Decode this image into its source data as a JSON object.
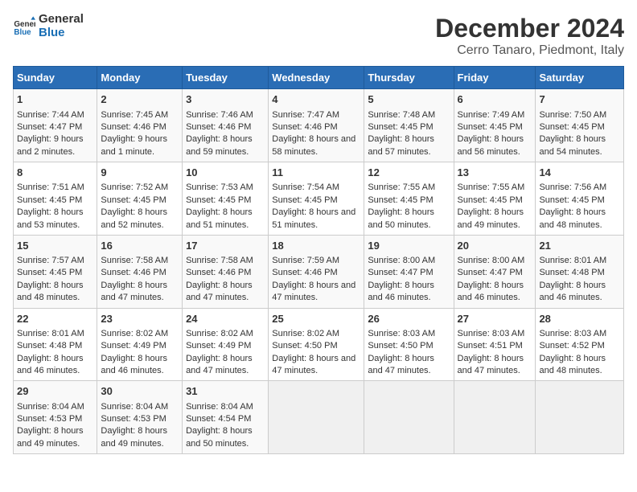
{
  "header": {
    "logo_general": "General",
    "logo_blue": "Blue",
    "title": "December 2024",
    "subtitle": "Cerro Tanaro, Piedmont, Italy"
  },
  "days_of_week": [
    "Sunday",
    "Monday",
    "Tuesday",
    "Wednesday",
    "Thursday",
    "Friday",
    "Saturday"
  ],
  "weeks": [
    [
      {
        "day": "1",
        "sunrise": "7:44 AM",
        "sunset": "4:47 PM",
        "daylight": "9 hours and 2 minutes."
      },
      {
        "day": "2",
        "sunrise": "7:45 AM",
        "sunset": "4:46 PM",
        "daylight": "9 hours and 1 minute."
      },
      {
        "day": "3",
        "sunrise": "7:46 AM",
        "sunset": "4:46 PM",
        "daylight": "8 hours and 59 minutes."
      },
      {
        "day": "4",
        "sunrise": "7:47 AM",
        "sunset": "4:46 PM",
        "daylight": "8 hours and 58 minutes."
      },
      {
        "day": "5",
        "sunrise": "7:48 AM",
        "sunset": "4:45 PM",
        "daylight": "8 hours and 57 minutes."
      },
      {
        "day": "6",
        "sunrise": "7:49 AM",
        "sunset": "4:45 PM",
        "daylight": "8 hours and 56 minutes."
      },
      {
        "day": "7",
        "sunrise": "7:50 AM",
        "sunset": "4:45 PM",
        "daylight": "8 hours and 54 minutes."
      }
    ],
    [
      {
        "day": "8",
        "sunrise": "7:51 AM",
        "sunset": "4:45 PM",
        "daylight": "8 hours and 53 minutes."
      },
      {
        "day": "9",
        "sunrise": "7:52 AM",
        "sunset": "4:45 PM",
        "daylight": "8 hours and 52 minutes."
      },
      {
        "day": "10",
        "sunrise": "7:53 AM",
        "sunset": "4:45 PM",
        "daylight": "8 hours and 51 minutes."
      },
      {
        "day": "11",
        "sunrise": "7:54 AM",
        "sunset": "4:45 PM",
        "daylight": "8 hours and 51 minutes."
      },
      {
        "day": "12",
        "sunrise": "7:55 AM",
        "sunset": "4:45 PM",
        "daylight": "8 hours and 50 minutes."
      },
      {
        "day": "13",
        "sunrise": "7:55 AM",
        "sunset": "4:45 PM",
        "daylight": "8 hours and 49 minutes."
      },
      {
        "day": "14",
        "sunrise": "7:56 AM",
        "sunset": "4:45 PM",
        "daylight": "8 hours and 48 minutes."
      }
    ],
    [
      {
        "day": "15",
        "sunrise": "7:57 AM",
        "sunset": "4:45 PM",
        "daylight": "8 hours and 48 minutes."
      },
      {
        "day": "16",
        "sunrise": "7:58 AM",
        "sunset": "4:46 PM",
        "daylight": "8 hours and 47 minutes."
      },
      {
        "day": "17",
        "sunrise": "7:58 AM",
        "sunset": "4:46 PM",
        "daylight": "8 hours and 47 minutes."
      },
      {
        "day": "18",
        "sunrise": "7:59 AM",
        "sunset": "4:46 PM",
        "daylight": "8 hours and 47 minutes."
      },
      {
        "day": "19",
        "sunrise": "8:00 AM",
        "sunset": "4:47 PM",
        "daylight": "8 hours and 46 minutes."
      },
      {
        "day": "20",
        "sunrise": "8:00 AM",
        "sunset": "4:47 PM",
        "daylight": "8 hours and 46 minutes."
      },
      {
        "day": "21",
        "sunrise": "8:01 AM",
        "sunset": "4:48 PM",
        "daylight": "8 hours and 46 minutes."
      }
    ],
    [
      {
        "day": "22",
        "sunrise": "8:01 AM",
        "sunset": "4:48 PM",
        "daylight": "8 hours and 46 minutes."
      },
      {
        "day": "23",
        "sunrise": "8:02 AM",
        "sunset": "4:49 PM",
        "daylight": "8 hours and 46 minutes."
      },
      {
        "day": "24",
        "sunrise": "8:02 AM",
        "sunset": "4:49 PM",
        "daylight": "8 hours and 47 minutes."
      },
      {
        "day": "25",
        "sunrise": "8:02 AM",
        "sunset": "4:50 PM",
        "daylight": "8 hours and 47 minutes."
      },
      {
        "day": "26",
        "sunrise": "8:03 AM",
        "sunset": "4:50 PM",
        "daylight": "8 hours and 47 minutes."
      },
      {
        "day": "27",
        "sunrise": "8:03 AM",
        "sunset": "4:51 PM",
        "daylight": "8 hours and 47 minutes."
      },
      {
        "day": "28",
        "sunrise": "8:03 AM",
        "sunset": "4:52 PM",
        "daylight": "8 hours and 48 minutes."
      }
    ],
    [
      {
        "day": "29",
        "sunrise": "8:04 AM",
        "sunset": "4:53 PM",
        "daylight": "8 hours and 49 minutes."
      },
      {
        "day": "30",
        "sunrise": "8:04 AM",
        "sunset": "4:53 PM",
        "daylight": "8 hours and 49 minutes."
      },
      {
        "day": "31",
        "sunrise": "8:04 AM",
        "sunset": "4:54 PM",
        "daylight": "8 hours and 50 minutes."
      },
      null,
      null,
      null,
      null
    ]
  ]
}
